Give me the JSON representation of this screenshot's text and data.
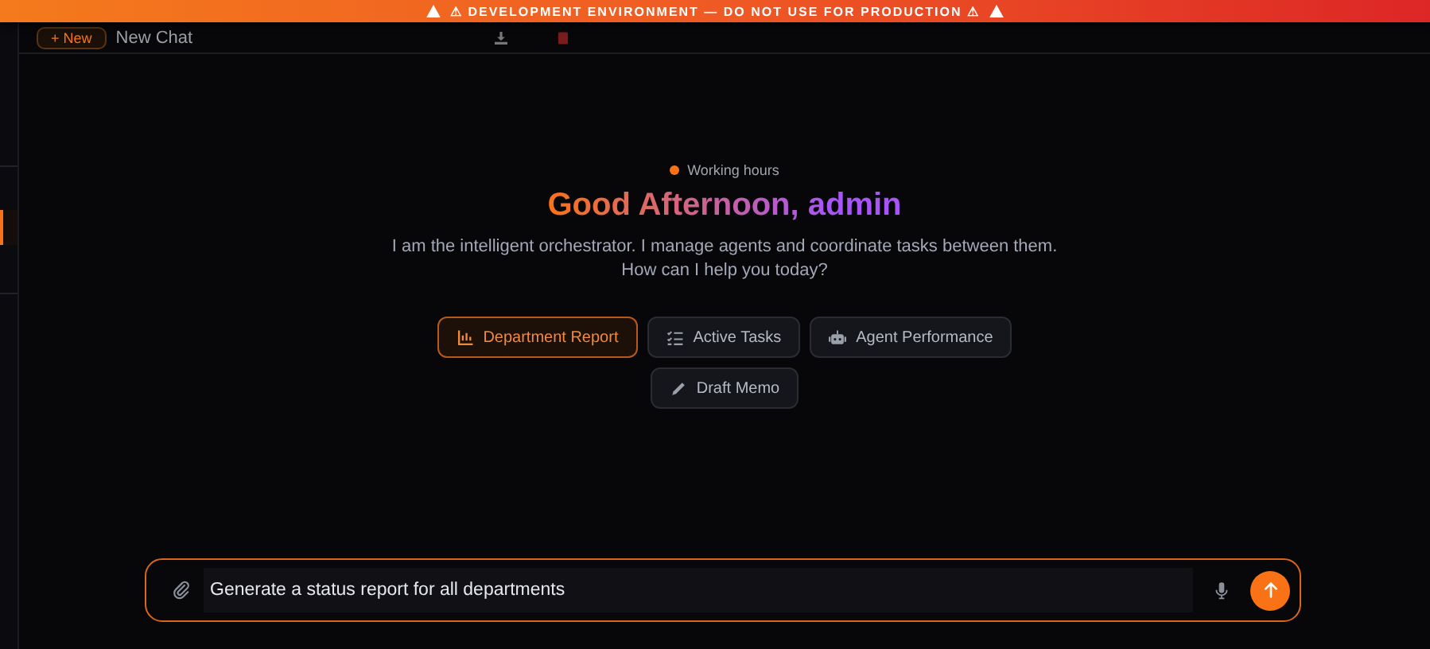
{
  "banner": {
    "text": "⚠ DEVELOPMENT ENVIRONMENT — DO NOT USE FOR PRODUCTION ⚠"
  },
  "header": {
    "new_button": "+ New",
    "chat_title": "New Chat"
  },
  "sidebar": {
    "active_item": true
  },
  "status": {
    "label": "Working hours"
  },
  "greeting": "Good Afternoon, admin",
  "description": [
    "I am the intelligent orchestrator. I manage agents and coordinate tasks between them.",
    "How can I help you today?"
  ],
  "suggestions": [
    {
      "label": "Department Report",
      "kind": "chart",
      "selected": true
    },
    {
      "label": "Active Tasks",
      "kind": "list",
      "selected": false
    },
    {
      "label": "Agent Performance",
      "kind": "robot",
      "selected": false
    },
    {
      "label": "Draft Memo",
      "kind": "pen",
      "selected": false
    }
  ],
  "composer": {
    "value": "Generate a status report for all departments"
  }
}
